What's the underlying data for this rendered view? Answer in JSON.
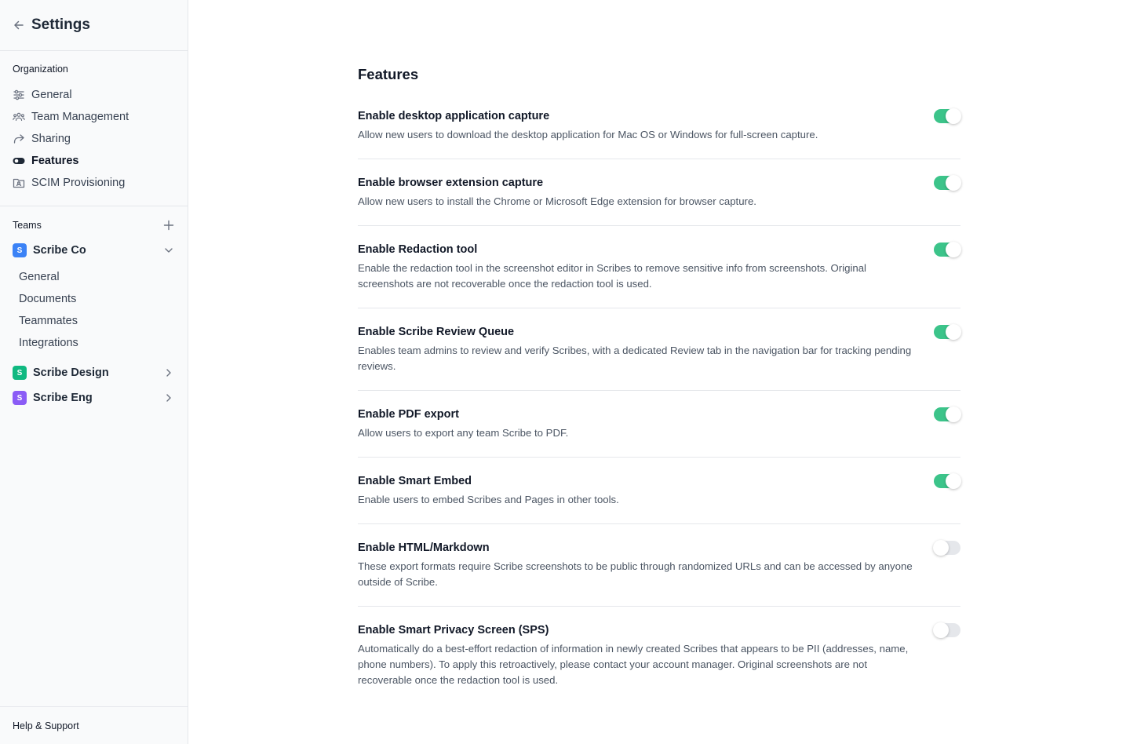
{
  "sidebar": {
    "title": "Settings",
    "organization": {
      "title": "Organization",
      "items": [
        {
          "label": "General",
          "icon": "sliders-icon"
        },
        {
          "label": "Team Management",
          "icon": "users-icon"
        },
        {
          "label": "Sharing",
          "icon": "share-arrow-icon"
        },
        {
          "label": "Features",
          "icon": "toggle-icon",
          "active": true
        },
        {
          "label": "SCIM Provisioning",
          "icon": "directory-icon"
        }
      ]
    },
    "teams": {
      "title": "Teams",
      "list": [
        {
          "initial": "S",
          "name": "Scribe Co",
          "color": "#3b82f6",
          "expanded": true,
          "items": [
            "General",
            "Documents",
            "Teammates",
            "Integrations"
          ]
        },
        {
          "initial": "S",
          "name": "Scribe Design",
          "color": "#10b981",
          "expanded": false
        },
        {
          "initial": "S",
          "name": "Scribe Eng",
          "color": "#8b5cf6",
          "expanded": false
        }
      ]
    },
    "footer": "Help & Support"
  },
  "main": {
    "title": "Features",
    "features": [
      {
        "title": "Enable desktop application capture",
        "desc": "Allow new users to download the desktop application for Mac OS or Windows for full-screen capture.",
        "enabled": true
      },
      {
        "title": "Enable browser extension capture",
        "desc": "Allow new users to install the Chrome or Microsoft Edge extension for browser capture.",
        "enabled": true
      },
      {
        "title": "Enable Redaction tool",
        "desc": "Enable the redaction tool in the screenshot editor in Scribes to remove sensitive info from screenshots. Original screenshots are not recoverable once the redaction tool is used.",
        "enabled": true
      },
      {
        "title": "Enable Scribe Review Queue",
        "desc": "Enables team admins to review and verify Scribes, with a dedicated Review tab in the navigation bar for tracking pending reviews.",
        "enabled": true
      },
      {
        "title": "Enable PDF export",
        "desc": "Allow users to export any team Scribe to PDF.",
        "enabled": true
      },
      {
        "title": "Enable Smart Embed",
        "desc": "Enable users to embed Scribes and Pages in other tools.",
        "enabled": true
      },
      {
        "title": "Enable HTML/Markdown",
        "desc": "These export formats require Scribe screenshots to be public through randomized URLs and can be accessed by anyone outside of Scribe.",
        "enabled": false
      },
      {
        "title": "Enable Smart Privacy Screen (SPS)",
        "desc": "Automatically do a best-effort redaction of information in newly created Scribes that appears to be PII (addresses, name, phone numbers). To apply this retroactively, please contact your account manager. Original screenshots are not recoverable once the redaction tool is used.",
        "enabled": false
      }
    ]
  },
  "colors": {
    "toggle_on": "#3cc48a",
    "toggle_off": "#e5e7eb",
    "sidebar_bg": "#f9fafb"
  }
}
